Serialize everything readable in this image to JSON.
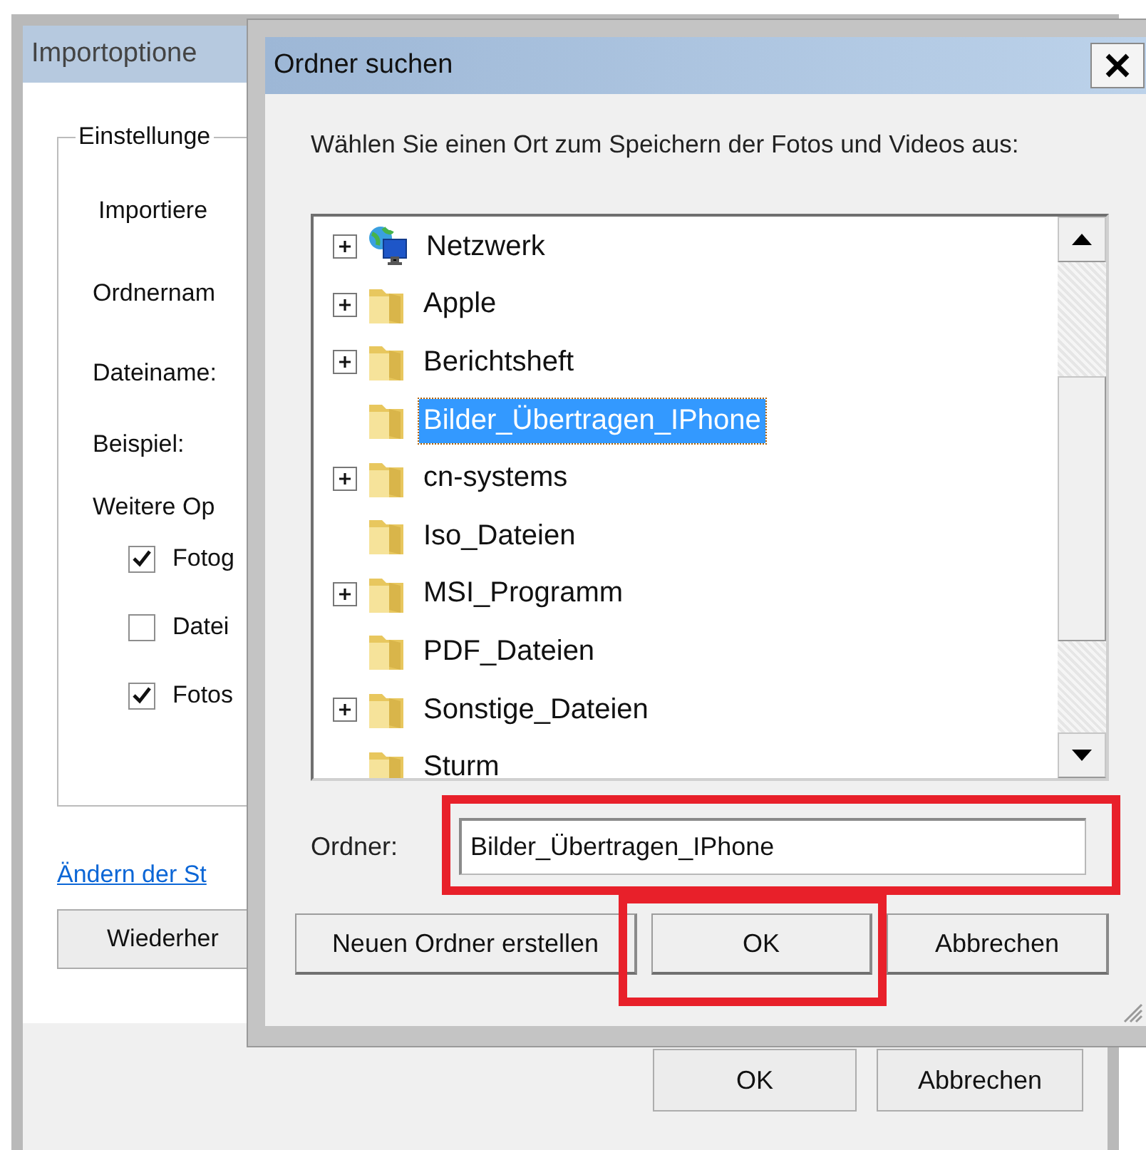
{
  "back_window": {
    "title": "Importoptione",
    "group_label": "Einstellunge",
    "fields": [
      {
        "label": "Importiere"
      },
      {
        "label": "Ordnernam"
      },
      {
        "label": "Dateiname:"
      },
      {
        "label": "Beispiel:"
      }
    ],
    "more_options_label": "Weitere Op",
    "options": [
      {
        "label": "Fotog",
        "checked": true
      },
      {
        "label": "Datei",
        "checked": false
      },
      {
        "label": "Fotos",
        "checked": true
      }
    ],
    "link": "Ändern der St",
    "restore_button": "Wiederher",
    "buttons": [
      "OK",
      "Abbrechen"
    ]
  },
  "dialog": {
    "title": "Ordner suchen",
    "prompt": "Wählen Sie einen Ort zum Speichern der Fotos und Videos aus:",
    "tree": [
      {
        "label": "Netzwerk",
        "kind": "network",
        "expandable": true,
        "selected": false
      },
      {
        "label": "Apple",
        "kind": "folder",
        "expandable": true,
        "selected": false
      },
      {
        "label": "Berichtsheft",
        "kind": "folder",
        "expandable": true,
        "selected": false
      },
      {
        "label": "Bilder_Übertragen_IPhone",
        "kind": "folder",
        "expandable": false,
        "selected": true
      },
      {
        "label": "cn-systems",
        "kind": "folder",
        "expandable": true,
        "selected": false
      },
      {
        "label": "Iso_Dateien",
        "kind": "folder",
        "expandable": false,
        "selected": false
      },
      {
        "label": "MSI_Programm",
        "kind": "folder",
        "expandable": true,
        "selected": false
      },
      {
        "label": "PDF_Dateien",
        "kind": "folder",
        "expandable": false,
        "selected": false
      },
      {
        "label": "Sonstige_Dateien",
        "kind": "folder",
        "expandable": true,
        "selected": false
      },
      {
        "label": "Sturm",
        "kind": "folder",
        "expandable": false,
        "selected": false
      }
    ],
    "folder_field": {
      "label": "Ordner:",
      "value": "Bilder_Übertragen_IPhone",
      "highlighted": true
    },
    "buttons": [
      {
        "label": "Neuen Ordner erstellen",
        "highlighted": false
      },
      {
        "label": "OK",
        "highlighted": true
      },
      {
        "label": "Abbrechen",
        "highlighted": false
      }
    ]
  }
}
